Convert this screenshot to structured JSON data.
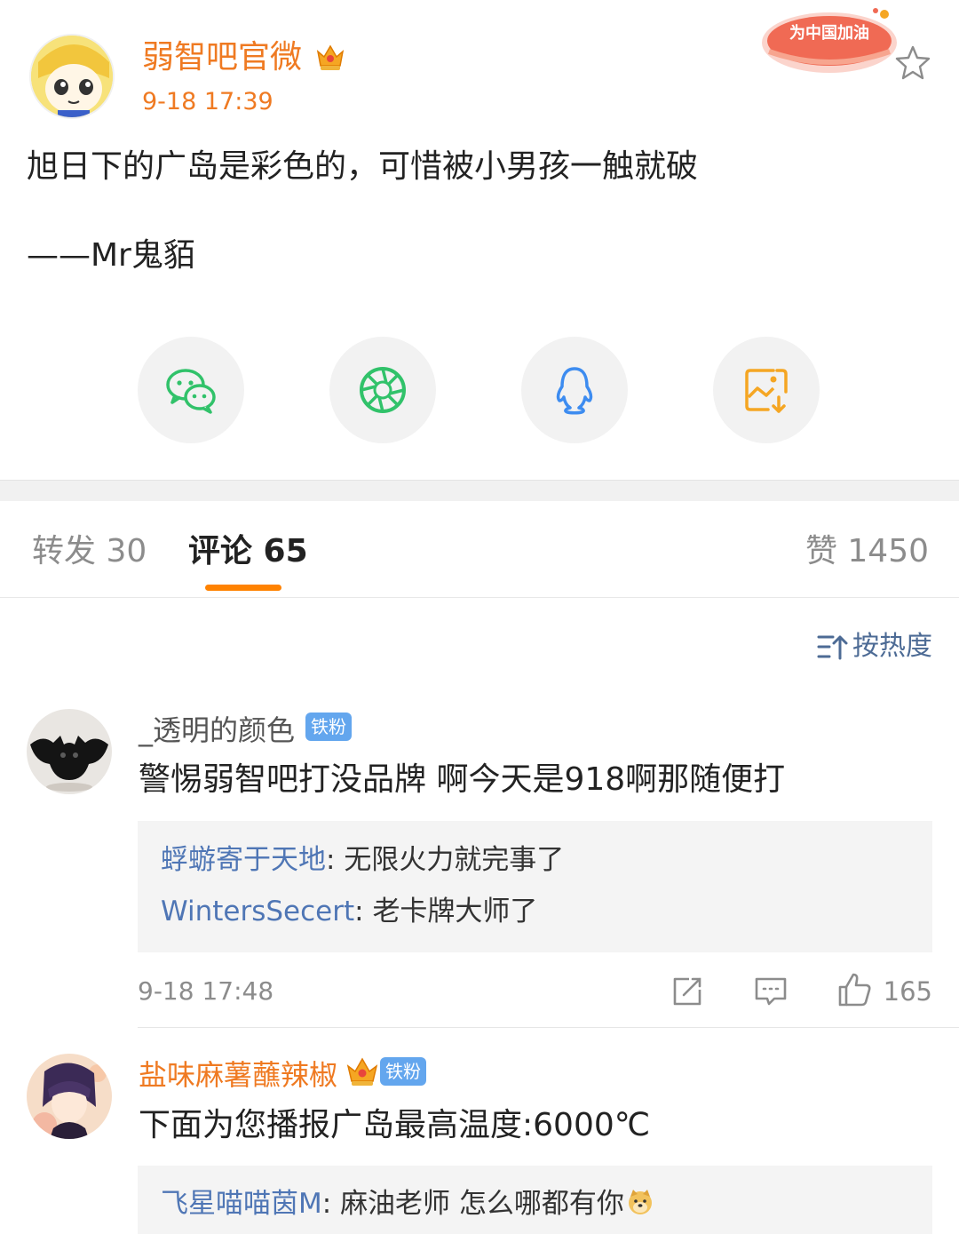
{
  "post": {
    "author": "弱智吧官微",
    "time": "9-18 17:39",
    "banner_text": "为中国加油",
    "text": "旭日下的广岛是彩色的，可惜被小男孩一触就破",
    "signature": "——Mr鬼貊"
  },
  "share": {
    "items": [
      {
        "icon": "wechat-icon",
        "color": "#31c26a"
      },
      {
        "icon": "moments-icon",
        "color": "#31c26a"
      },
      {
        "icon": "qq-icon",
        "color": "#3d8cf0"
      },
      {
        "icon": "save-image-icon",
        "color": "#f5a623"
      }
    ]
  },
  "tabs": {
    "repost": "转发 30",
    "comments": "评论 65",
    "likes": "赞 1450"
  },
  "sort": {
    "label": "按热度"
  },
  "comments": [
    {
      "user": "_透明的颜色",
      "badge": "铁粉",
      "text": "警惕弱智吧打没品牌 啊今天是918啊那随便打",
      "replies": [
        {
          "user": "蜉蝣寄于天地",
          "sep": ": ",
          "text": "无限火力就完事了"
        },
        {
          "user": "WintersSecert",
          "sep": ": ",
          "text": "老卡牌大师了"
        }
      ],
      "time": "9-18 17:48",
      "likes": "165"
    },
    {
      "user": "盐味麻薯蘸辣椒",
      "badge": "铁粉",
      "text": "下面为您播报广岛最高温度:6000℃",
      "replies": [
        {
          "user": "飞星喵喵茵M",
          "sep": ": ",
          "text": "麻油老师 怎么哪都有你"
        }
      ]
    }
  ],
  "colors": {
    "accent_orange": "#ef7a22",
    "tab_indicator": "#ff8200",
    "link_blue": "#4f76b5",
    "fan_badge": "#63a6ee"
  }
}
